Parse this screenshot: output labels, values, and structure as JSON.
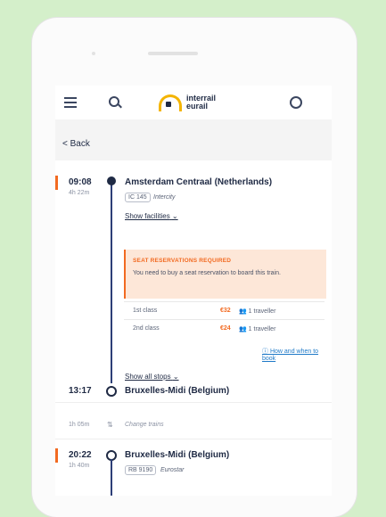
{
  "header": {
    "logo_line1": "interrail",
    "logo_line2": "eurail"
  },
  "nav": {
    "back_label": "< Back"
  },
  "segments": [
    {
      "time": "09:08",
      "duration": "4h 22m",
      "station": "Amsterdam Centraal (Netherlands)",
      "train_code": "IC 145",
      "train_type": "Intercity",
      "facilities_link": "Show facilities",
      "reservation": {
        "title": "SEAT RESERVATIONS REQUIRED",
        "text": "You need to buy a seat reservation to board this train.",
        "rows": [
          {
            "class": "1st class",
            "price": "€32",
            "travellers": "1 traveller"
          },
          {
            "class": "2nd class",
            "price": "€24",
            "travellers": "1 traveller"
          }
        ],
        "how_link": "How and when to book"
      },
      "stops_link": "Show all stops",
      "arrival_time": "13:17",
      "arrival_station": "Bruxelles-Midi (Belgium)"
    }
  ],
  "change": {
    "duration": "1h 05m",
    "label": "Change trains"
  },
  "segment2": {
    "time": "20:22",
    "duration": "1h 40m",
    "station": "Bruxelles-Midi (Belgium)",
    "train_code": "RB 9190",
    "train_type": "Eurostar"
  },
  "colors": {
    "accent": "#f26a21",
    "timeline": "#2d3f77",
    "background": "#d4efca"
  }
}
